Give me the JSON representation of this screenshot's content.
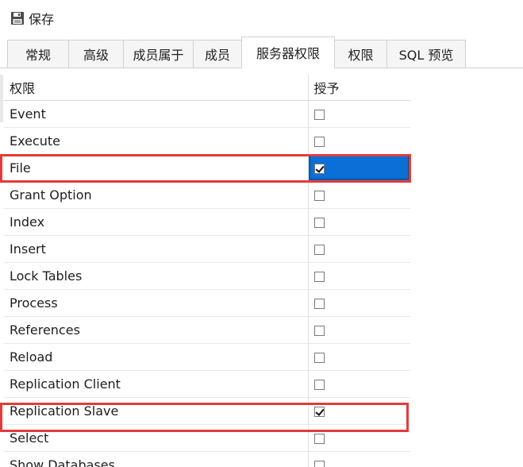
{
  "toolbar": {
    "save_label": "保存",
    "save_icon": "save-disk-icon"
  },
  "tabs": [
    {
      "label": "常规",
      "active": false
    },
    {
      "label": "高级",
      "active": false
    },
    {
      "label": "成员属于",
      "active": false
    },
    {
      "label": "成员",
      "active": false
    },
    {
      "label": "服务器权限",
      "active": true
    },
    {
      "label": "权限",
      "active": false
    },
    {
      "label": "SQL 预览",
      "active": false
    }
  ],
  "grid": {
    "headers": {
      "privilege": "权限",
      "grant": "授予"
    },
    "rows": [
      {
        "name": "Event",
        "granted": false
      },
      {
        "name": "Execute",
        "granted": false
      },
      {
        "name": "File",
        "granted": true
      },
      {
        "name": "Grant Option",
        "granted": false
      },
      {
        "name": "Index",
        "granted": false
      },
      {
        "name": "Insert",
        "granted": false
      },
      {
        "name": "Lock Tables",
        "granted": false
      },
      {
        "name": "Process",
        "granted": false
      },
      {
        "name": "References",
        "granted": false
      },
      {
        "name": "Reload",
        "granted": false
      },
      {
        "name": "Replication Client",
        "granted": false
      },
      {
        "name": "Replication Slave",
        "granted": true
      },
      {
        "name": "Select",
        "granted": false
      },
      {
        "name": "Show Databases",
        "granted": false
      }
    ]
  },
  "colors": {
    "highlight": "#e53a3a",
    "selection": "#0a6fd6"
  }
}
